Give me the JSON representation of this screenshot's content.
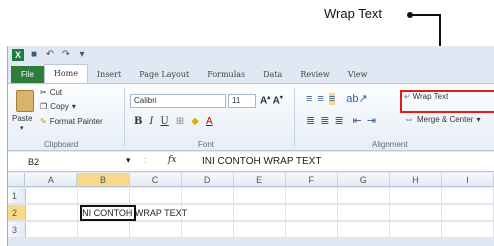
{
  "callout": {
    "label": "Wrap Text"
  },
  "window": {
    "tabs": [
      "File",
      "Home",
      "Insert",
      "Page Layout",
      "Formulas",
      "Data",
      "Review",
      "View"
    ],
    "active_tab": "Home",
    "clipboard": {
      "paste": "Paste",
      "cut": "Cut",
      "copy": "Copy",
      "format_painter": "Format Painter",
      "group": "Clipboard"
    },
    "font": {
      "name": "Calibri",
      "size": "11",
      "group": "Font"
    },
    "alignment": {
      "wrap_text": "Wrap Text",
      "merge_center": "Merge & Center",
      "group": "Alignment"
    },
    "formula_bar": {
      "name_box": "B2",
      "fx": "fx",
      "content": "INI CONTOH WRAP TEXT"
    },
    "grid": {
      "columns": [
        "A",
        "B",
        "C",
        "D",
        "E",
        "F",
        "G",
        "H",
        "I"
      ],
      "rows": [
        "1",
        "2",
        "3"
      ],
      "cell_b2": "INI CONTOH WRAP TEXT"
    }
  }
}
